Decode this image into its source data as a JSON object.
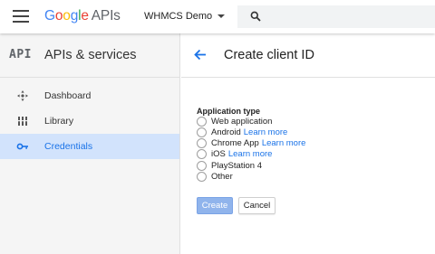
{
  "header": {
    "logo_letters": [
      "G",
      "o",
      "o",
      "g",
      "l",
      "e"
    ],
    "logo_suffix": "APIs",
    "project_name": "WHMCS Demo"
  },
  "sidebar": {
    "badge": "API",
    "title": "APIs & services",
    "items": [
      {
        "label": "Dashboard",
        "icon": "dashboard-icon"
      },
      {
        "label": "Library",
        "icon": "library-icon"
      },
      {
        "label": "Credentials",
        "icon": "key-icon",
        "active": true
      }
    ]
  },
  "main": {
    "title": "Create client ID",
    "section_label": "Application type",
    "options": [
      {
        "label": "Web application",
        "link": ""
      },
      {
        "label": "Android",
        "link": "Learn more"
      },
      {
        "label": "Chrome App",
        "link": "Learn more"
      },
      {
        "label": "iOS",
        "link": "Learn more"
      },
      {
        "label": "PlayStation 4",
        "link": ""
      },
      {
        "label": "Other",
        "link": ""
      }
    ],
    "create_label": "Create",
    "cancel_label": "Cancel"
  },
  "colors": {
    "accent": "#1a73e8",
    "active_nav_bg": "#d2e3fc",
    "create_button_bg": "#90b4ec"
  }
}
